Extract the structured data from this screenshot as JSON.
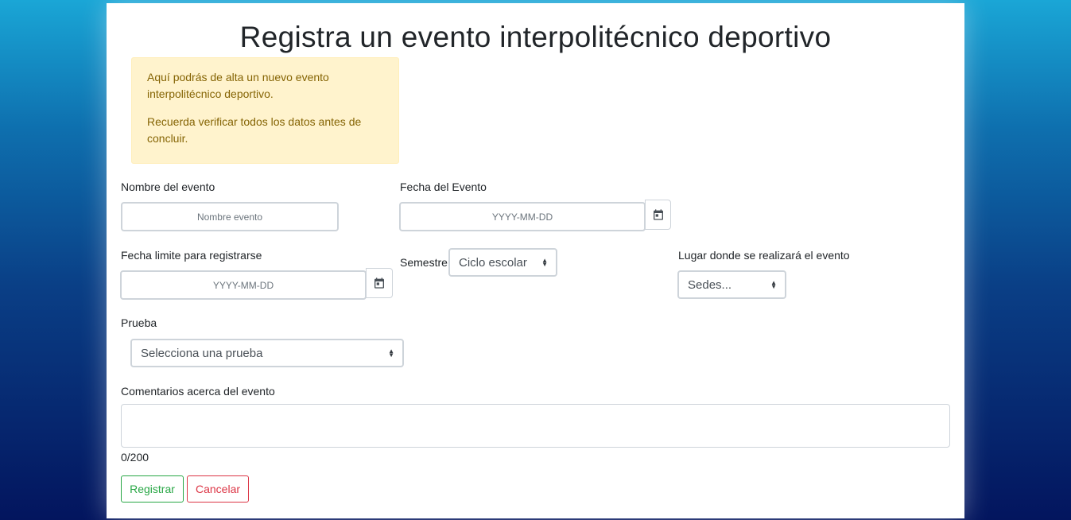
{
  "page": {
    "title": "Registra un evento interpolitécnico deportivo"
  },
  "alert": {
    "line1": "Aquí podrás de alta un nuevo evento interpolitécnico deportivo.",
    "line2": "Recuerda verificar todos los datos antes de concluir."
  },
  "fields": {
    "nombre": {
      "label": "Nombre del evento",
      "placeholder": "Nombre evento"
    },
    "fecha_evento": {
      "label": "Fecha del Evento",
      "placeholder": "YYYY-MM-DD"
    },
    "fecha_limite": {
      "label": "Fecha limite para registrarse",
      "placeholder": "YYYY-MM-DD"
    },
    "semestre": {
      "label": "Semestre",
      "selected": "Ciclo escolar"
    },
    "lugar": {
      "label": "Lugar donde se realizará el evento",
      "selected": "Sedes..."
    },
    "prueba": {
      "label": "Prueba",
      "selected": "Selecciona una prueba"
    },
    "comentarios": {
      "label": "Comentarios acerca del evento",
      "counter": "0/200",
      "value": ""
    }
  },
  "buttons": {
    "registrar": "Registrar",
    "cancelar": "Cancelar"
  },
  "icons": {
    "calendar": "calendar-icon",
    "select_arrows": "sort-arrows-icon"
  },
  "colors": {
    "alert_bg": "#fff3cd",
    "alert_text": "#856404",
    "success": "#28a745",
    "danger": "#dc3545"
  }
}
